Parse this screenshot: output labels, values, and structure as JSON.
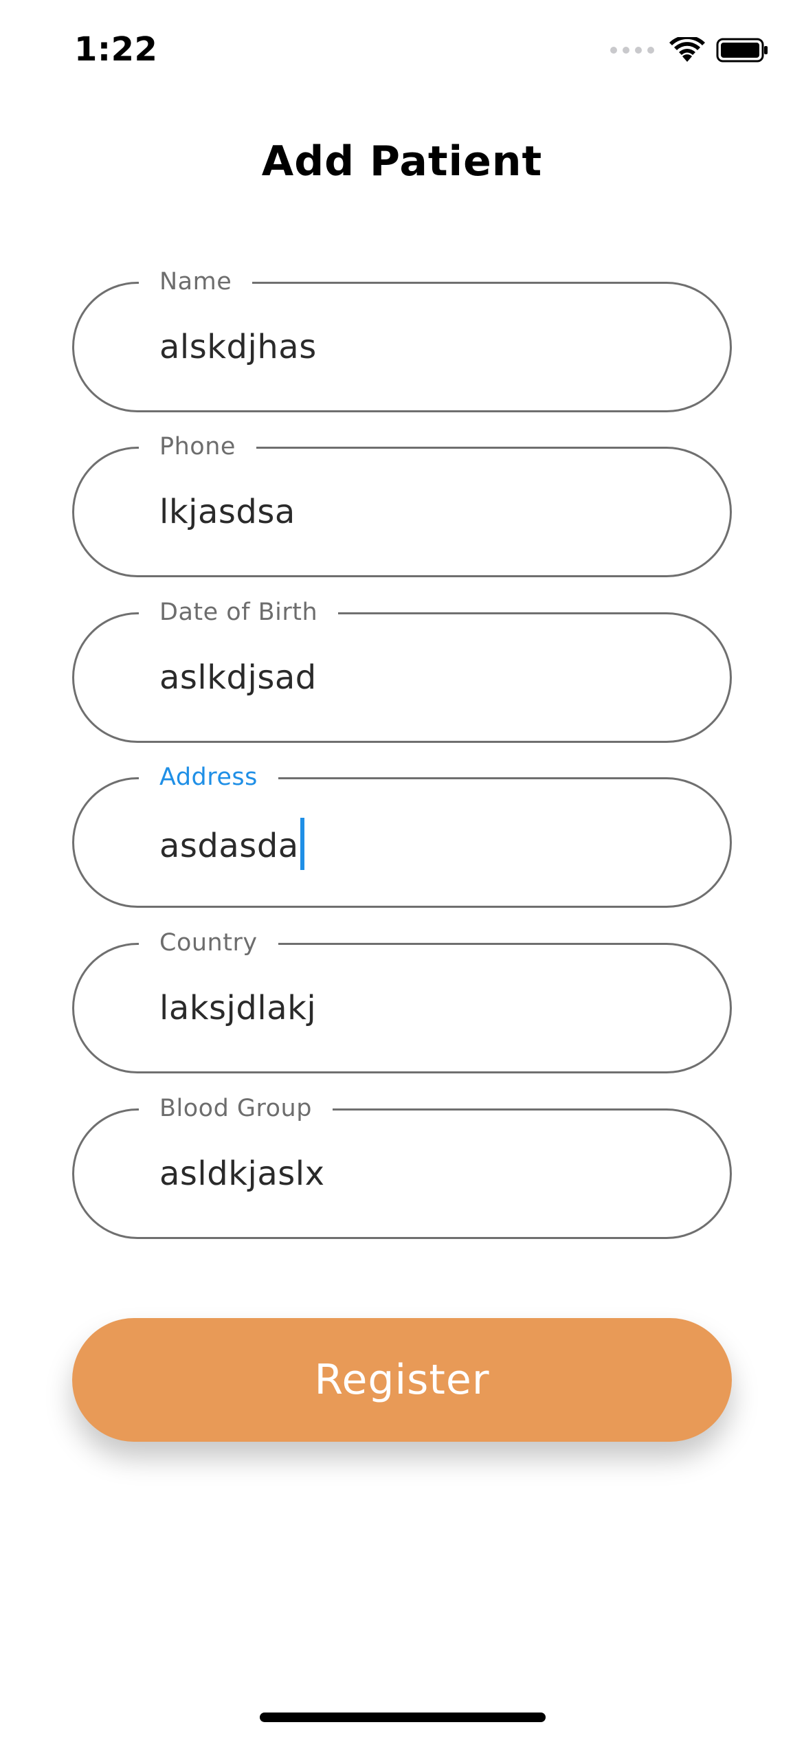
{
  "status_bar": {
    "time": "1:22",
    "icons": [
      "cellular-signal-icon",
      "wifi-icon",
      "battery-icon"
    ]
  },
  "page": {
    "title": "Add Patient"
  },
  "form": {
    "fields": [
      {
        "label": "Name",
        "value": "alskdjhas",
        "focused": false
      },
      {
        "label": "Phone",
        "value": "lkjasdsa",
        "focused": false
      },
      {
        "label": "Date of Birth",
        "value": "aslkdjsad",
        "focused": false
      },
      {
        "label": "Address",
        "value": "asdasda",
        "focused": true
      },
      {
        "label": "Country",
        "value": "laksjdlakj",
        "focused": false
      },
      {
        "label": "Blood Group",
        "value": "asldkjaslx",
        "focused": false
      }
    ]
  },
  "actions": {
    "register_label": "Register"
  },
  "colors": {
    "accent_button": "#e89a57",
    "focus_blue": "#1f8fe6",
    "field_border": "#6f6f6f",
    "label_gray": "#6d6d6d"
  }
}
